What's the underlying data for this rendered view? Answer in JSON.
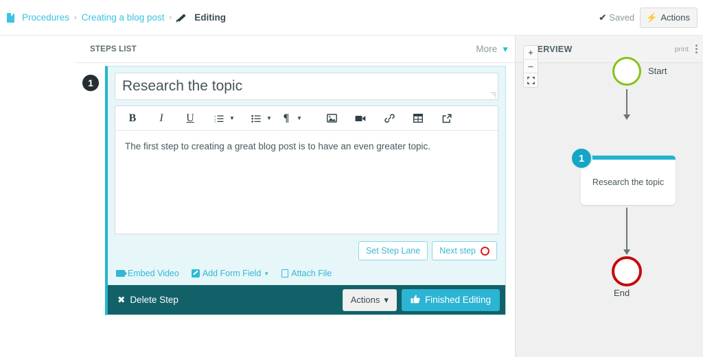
{
  "breadcrumb": {
    "doc_icon": "document-icon",
    "procedures": "Procedures",
    "sep": "›",
    "blog_post": "Creating a blog post",
    "pencil_icon": "pencil-icon",
    "editing": "Editing"
  },
  "topbar": {
    "saved_label": "Saved",
    "check_glyph": "✔",
    "actions_label": "Actions",
    "bolt_glyph": "⚡"
  },
  "steps_panel": {
    "header": "STEPS LIST",
    "more_label": "More",
    "chevron_glyph": "⌄"
  },
  "step": {
    "number": "1",
    "title": "Research the topic",
    "body": "The first step to creating a great blog post is to have an even greater topic.",
    "toolbar": [
      {
        "name": "bold-icon",
        "glyph": "B",
        "style": "b",
        "caret": false
      },
      {
        "name": "italic-icon",
        "glyph": "I",
        "style": "i",
        "caret": false
      },
      {
        "name": "underline-icon",
        "glyph": "U",
        "style": "u",
        "caret": false
      },
      {
        "name": "ordered-list-icon",
        "glyph": "☰",
        "style": "",
        "caret": true
      },
      {
        "name": "unordered-list-icon",
        "glyph": "≡",
        "style": "",
        "caret": true
      },
      {
        "name": "paragraph-icon",
        "glyph": "¶",
        "style": "",
        "caret": true
      }
    ],
    "toolbar2": [
      {
        "name": "insert-image-icon",
        "glyph": "🖻"
      },
      {
        "name": "insert-video-icon",
        "glyph": "▬"
      },
      {
        "name": "insert-link-icon",
        "glyph": "🔗"
      },
      {
        "name": "insert-table-icon",
        "glyph": "⌸"
      },
      {
        "name": "popout-editor-icon",
        "glyph": "↗"
      }
    ],
    "set_step_lane": "Set Step Lane",
    "next_step": "Next step",
    "links": [
      {
        "name": "embed-video-link",
        "label": "Embed Video",
        "icon": "video-icon",
        "caret": false
      },
      {
        "name": "add-form-field-link",
        "label": "Add Form Field",
        "icon": "form-icon",
        "caret": true
      },
      {
        "name": "attach-file-link",
        "label": "Attach File",
        "icon": "file-icon",
        "caret": false
      }
    ],
    "footer": {
      "delete_label": "Delete Step",
      "delete_glyph": "✖",
      "actions_label": "Actions",
      "actions_caret": "▾",
      "finished_label": "Finished Editing",
      "thumb_glyph": "👍"
    }
  },
  "overview": {
    "header": "OVERVIEW",
    "print_label": "print",
    "menu_icon": "kebab-menu-icon",
    "zoom_in": "+",
    "zoom_out": "–",
    "fit_screen": "⛶",
    "nodes": {
      "start_label": "Start",
      "step_badge": "1",
      "step_label": "Research the topic",
      "end_label": "End"
    }
  },
  "colors": {
    "accent_cyan": "#2cb4d4",
    "teal_dark": "#126169",
    "start_green": "#84c318",
    "end_red": "#c60a0a",
    "link_cyan": "#2fb9d6"
  }
}
